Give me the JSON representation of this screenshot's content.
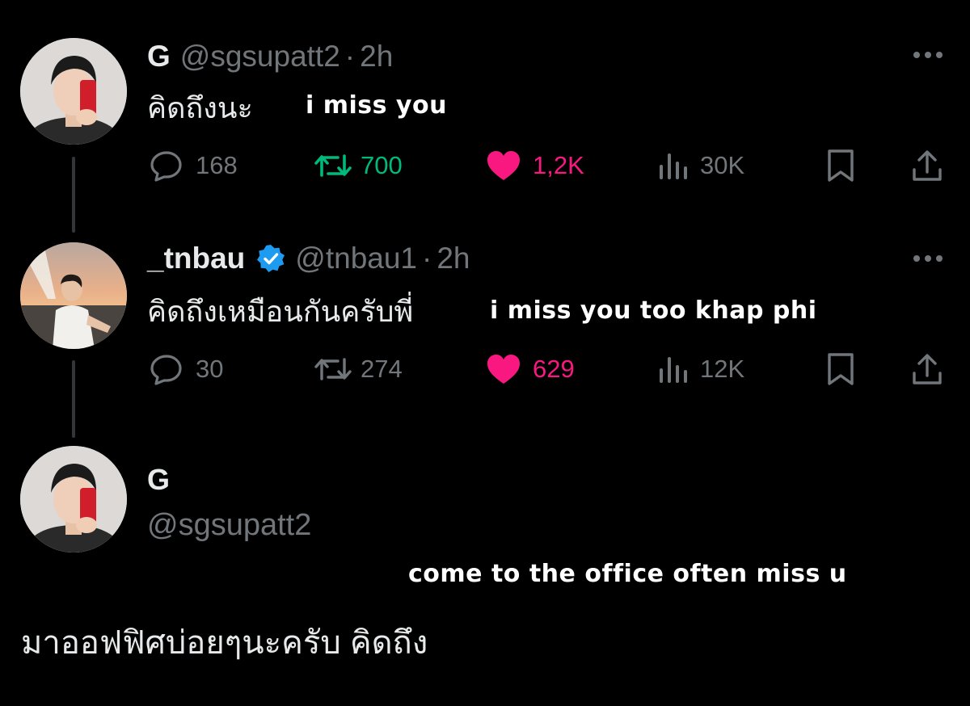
{
  "colors": {
    "background": "#000000",
    "text": "#e7e9ea",
    "muted": "#71767b",
    "retweet": "#00ba7c",
    "like": "#f91880",
    "verified": "#1d9bf0"
  },
  "tweets": [
    {
      "display_name": "G",
      "handle": "@sgsupatt2",
      "separator": "·",
      "time": "2h",
      "text": "คิดถึงนะ",
      "overlay": "i miss you",
      "replies": "168",
      "retweets": "700",
      "likes": "1,2K",
      "views": "30K",
      "icons": [
        "avatar",
        "more-icon",
        "reply-icon",
        "retweet-icon",
        "heart-icon",
        "views-icon",
        "bookmark-icon",
        "share-icon"
      ]
    },
    {
      "display_name": "_tnbau",
      "handle": "@tnbau1",
      "separator": "·",
      "time": "2h",
      "text": "คิดถึงเหมือนกันครับพี่",
      "overlay": "i miss you too khap phi",
      "replies": "30",
      "retweets": "274",
      "likes": "629",
      "views": "12K",
      "icons": [
        "avatar",
        "verified-badge-icon",
        "more-icon",
        "reply-icon",
        "retweet-icon",
        "heart-icon",
        "views-icon",
        "bookmark-icon",
        "share-icon"
      ]
    }
  ],
  "main_tweet": {
    "display_name": "G",
    "handle": "@sgsupatt2",
    "overlay": "come to the office often miss u",
    "text": "มาออฟฟิศบ่อยๆนะครับ คิดถึง"
  }
}
